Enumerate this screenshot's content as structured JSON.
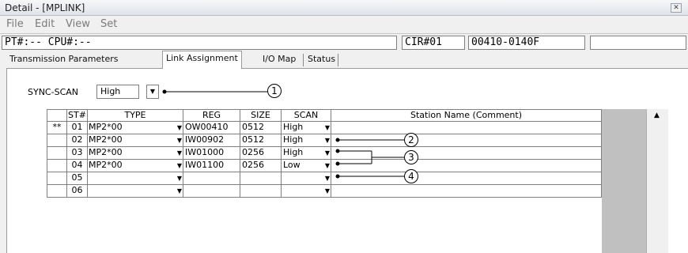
{
  "window": {
    "title": "Detail - [MPLINK]"
  },
  "menu": [
    "File",
    "Edit",
    "View",
    "Set"
  ],
  "status": {
    "pt": "PT#:-- CPU#:--",
    "cir": "CIR#01",
    "code": "00410-0140F",
    "extra": ""
  },
  "tabs": [
    "Transmission Parameters",
    "Link Assignment",
    "I/O Map",
    "Status"
  ],
  "sync": {
    "label": "SYNC-SCAN",
    "value": "High",
    "callout": "1"
  },
  "table": {
    "headers": [
      "ST#",
      "TYPE",
      "REG",
      "SIZE",
      "SCAN",
      "Station Name (Comment)"
    ],
    "rows": [
      {
        "mark": "**",
        "st": "01",
        "type": "MP2*00",
        "reg": "OW00410",
        "size": "0512",
        "scan": "High"
      },
      {
        "mark": "",
        "st": "02",
        "type": "MP2*00",
        "reg": "IW00902",
        "size": "0512",
        "scan": "High"
      },
      {
        "mark": "",
        "st": "03",
        "type": "MP2*00",
        "reg": "IW01000",
        "size": "0256",
        "scan": "High"
      },
      {
        "mark": "",
        "st": "04",
        "type": "MP2*00",
        "reg": "IW01100",
        "size": "0256",
        "scan": "Low"
      },
      {
        "mark": "",
        "st": "05",
        "type": "",
        "reg": "",
        "size": "",
        "scan": ""
      },
      {
        "mark": "",
        "st": "06",
        "type": "",
        "reg": "",
        "size": "",
        "scan": ""
      }
    ]
  },
  "callouts": [
    "2",
    "3",
    "4"
  ]
}
